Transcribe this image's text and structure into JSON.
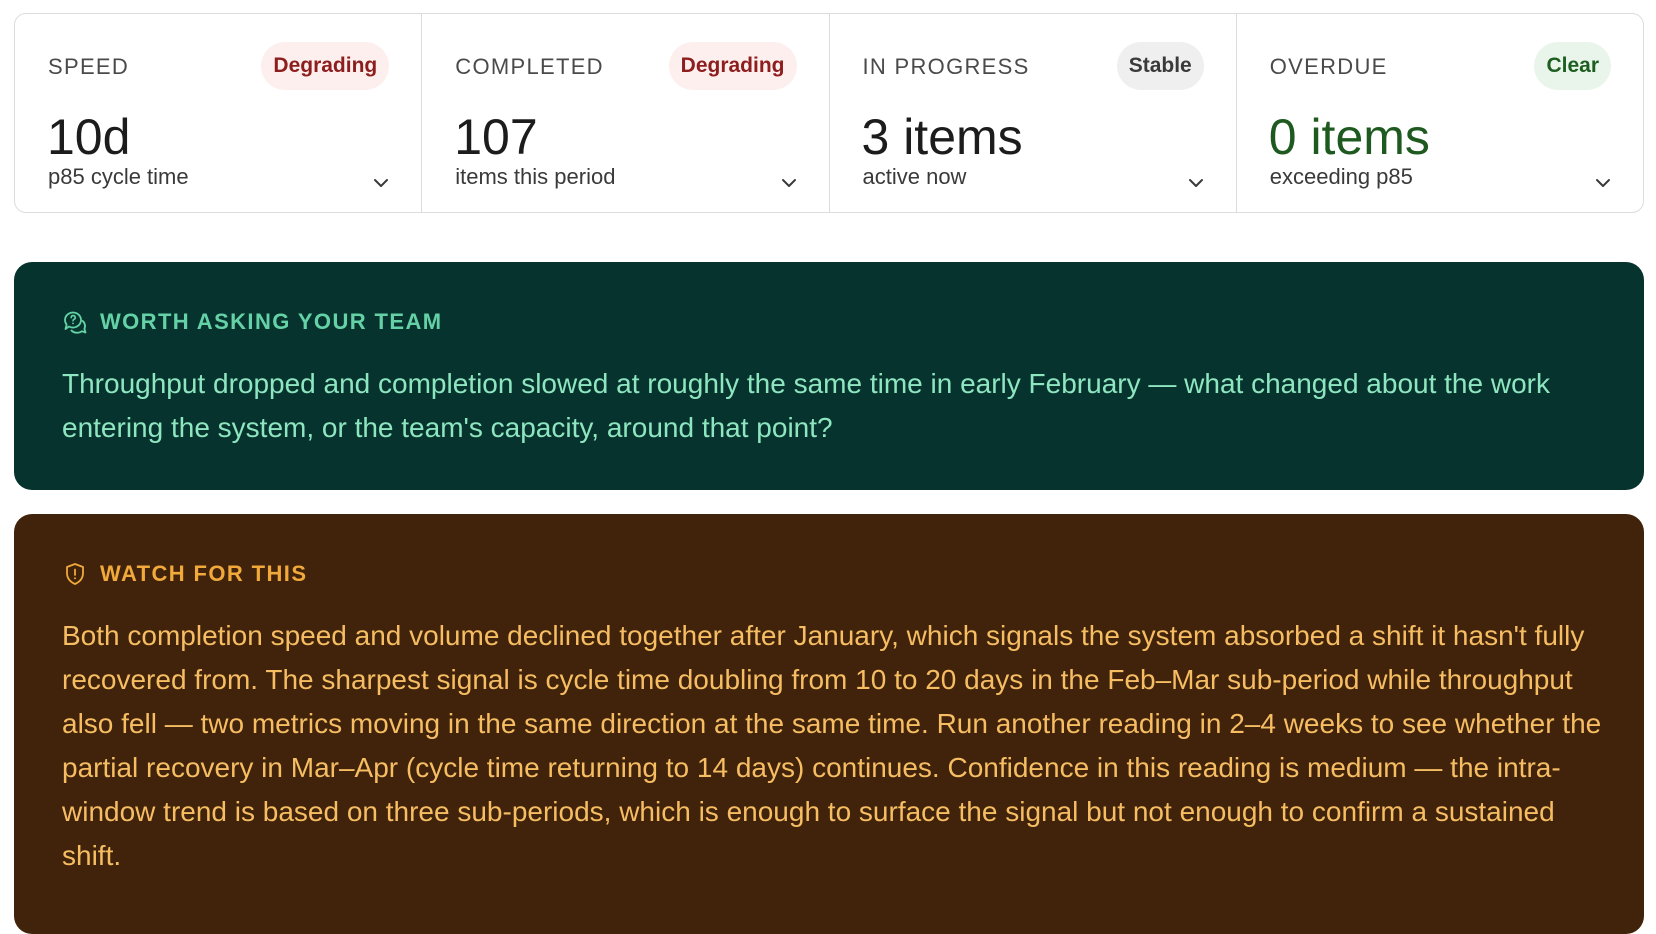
{
  "metrics": [
    {
      "label": "SPEED",
      "badge": "Degrading",
      "badge_status": "degrading",
      "value": "10d",
      "sub": "p85 cycle time",
      "expand_icon": "chevron-down-icon"
    },
    {
      "label": "COMPLETED",
      "badge": "Degrading",
      "badge_status": "degrading",
      "value": "107",
      "sub": "items this period",
      "expand_icon": "chevron-down-icon"
    },
    {
      "label": "IN PROGRESS",
      "badge": "Stable",
      "badge_status": "stable",
      "value": "3 items",
      "sub": "active now",
      "expand_icon": "chevron-down-icon"
    },
    {
      "label": "OVERDUE",
      "badge": "Clear",
      "badge_status": "clear",
      "value": "0 items",
      "sub": "exceeding p85",
      "expand_icon": "chevron-down-icon"
    }
  ],
  "ask": {
    "icon": "chat-question-icon",
    "heading": "WORTH ASKING YOUR TEAM",
    "body": "Throughput dropped and completion slowed at roughly the same time in early February — what changed about the work entering the system, or the team's capacity, around that point?"
  },
  "watch": {
    "icon": "shield-alert-icon",
    "heading": "WATCH FOR THIS",
    "body": "Both completion speed and volume declined together after January, which signals the system absorbed a shift it hasn't fully recovered from. The sharpest signal is cycle time doubling from 10 to 20 days in the Feb–Mar sub-period while throughput also fell — two metrics moving in the same direction at the same time. Run another reading in 2–4 weeks to see whether the partial recovery in Mar–Apr (cycle time returning to 14 days) continues. Confidence in this reading is medium — the intra-window trend is based on three sub-periods, which is enough to surface the signal but not enough to confirm a sustained shift."
  },
  "colors": {
    "degrading_badge_bg": "#fcefee",
    "degrading_badge_text": "#8e1d1d",
    "stable_badge_bg": "#efefef",
    "clear_badge_bg": "#e9f5ea",
    "clear_text": "#1e5a1f",
    "ask_bg": "#06332d",
    "ask_accent": "#64d2a6",
    "watch_bg": "#40230a",
    "watch_accent": "#f0a93a"
  }
}
